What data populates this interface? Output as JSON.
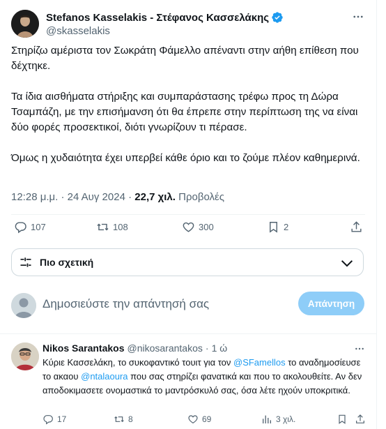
{
  "author": {
    "name": "Stefanos Kasselakis - Στέφανος Κασσελάκης",
    "handle": "@skasselakis"
  },
  "tweet": {
    "paragraphs": [
      "Στηρίζω αμέριστα τον Σωκράτη Φάμελλο απέναντι στην αήθη επίθεση που δέχτηκε.",
      "Τα ίδια αισθήματα στήριξης και συμπαράστασης τρέφω προς τη Δώρα Τσαμπάζη, με την επισήμανση ότι θα έπρεπε στην περίπτωση της να είναι δύο φορές προσεκτικοί, διότι γνωρίζουν τι πέρασε.",
      "Όμως η χυδαιότητα έχει υπερβεί κάθε όριο και το ζούμε πλέον καθημερινά."
    ],
    "timestamp": "12:28 μ.μ. · 24 Αυγ 2024 · ",
    "views_count": "22,7 χιλ.",
    "views_label": " Προβολές"
  },
  "actions": {
    "replies": "107",
    "reposts": "108",
    "likes": "300",
    "bookmarks": "2"
  },
  "sort": {
    "label": "Πιο σχετική"
  },
  "composer": {
    "placeholder": "Δημοσιεύστε την απάντησή σας",
    "button": "Απάντηση"
  },
  "reply": {
    "name": "Nikos Sarantakos",
    "handle": "@nikosarantakos",
    "time": "1 ώ",
    "text_1": "Κύριε Κασσελάκη, το συκοφαντικό τουιτ για τον ",
    "mention_1": "@SFamellos",
    "text_2": " το αναδημοσίευσε το ακαου ",
    "mention_2": "@ntalaoura",
    "text_3": " που σας στηρίζει φανατικά και που το ακολουθείτε. Αν δεν αποδοκιμασετε ονομαστικά το μαντρόσκυλό σας, όσα λέτε ηχούν υποκριτικά.",
    "replies": "17",
    "reposts": "8",
    "likes": "69",
    "views": "3 χιλ."
  },
  "colors": {
    "accent": "#1d9bf0",
    "reply_button_disabled": "#8ecdf8",
    "secondary_text": "#536471"
  }
}
